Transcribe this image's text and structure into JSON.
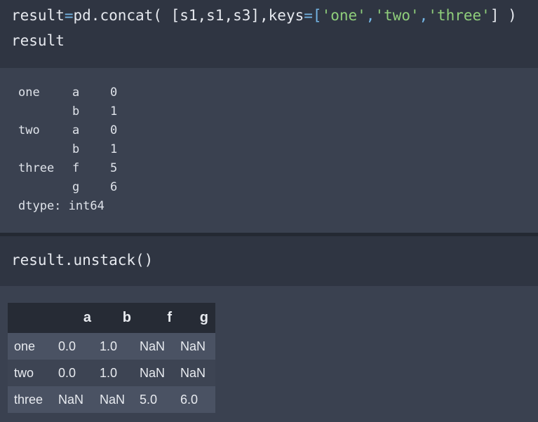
{
  "cell1": {
    "input": {
      "line1": {
        "t1": "result",
        "t2": "=",
        "t3": "pd.concat( [s1,s1,s3],keys",
        "t4": "=",
        "t5": "[",
        "t6": "'one'",
        "t7": ",",
        "t8": "'two'",
        "t9": ",",
        "t10": "'three'",
        "t11": "] )"
      },
      "line2": "result"
    },
    "output": {
      "rows": [
        {
          "level0": "one",
          "level1": "a",
          "value": "0"
        },
        {
          "level0": "",
          "level1": "b",
          "value": "1"
        },
        {
          "level0": "two",
          "level1": "a",
          "value": "0"
        },
        {
          "level0": "",
          "level1": "b",
          "value": "1"
        },
        {
          "level0": "three",
          "level1": "f",
          "value": "5"
        },
        {
          "level0": "",
          "level1": "g",
          "value": "6"
        }
      ],
      "dtype": "dtype: int64"
    }
  },
  "cell2": {
    "input": "result.unstack()",
    "output": {
      "columns": [
        "",
        "a",
        "b",
        "f",
        "g"
      ],
      "rows": [
        {
          "index": "one",
          "values": [
            "0.0",
            "1.0",
            "NaN",
            "NaN"
          ]
        },
        {
          "index": "two",
          "values": [
            "0.0",
            "1.0",
            "NaN",
            "NaN"
          ]
        },
        {
          "index": "three",
          "values": [
            "NaN",
            "NaN",
            "5.0",
            "6.0"
          ]
        }
      ]
    }
  }
}
